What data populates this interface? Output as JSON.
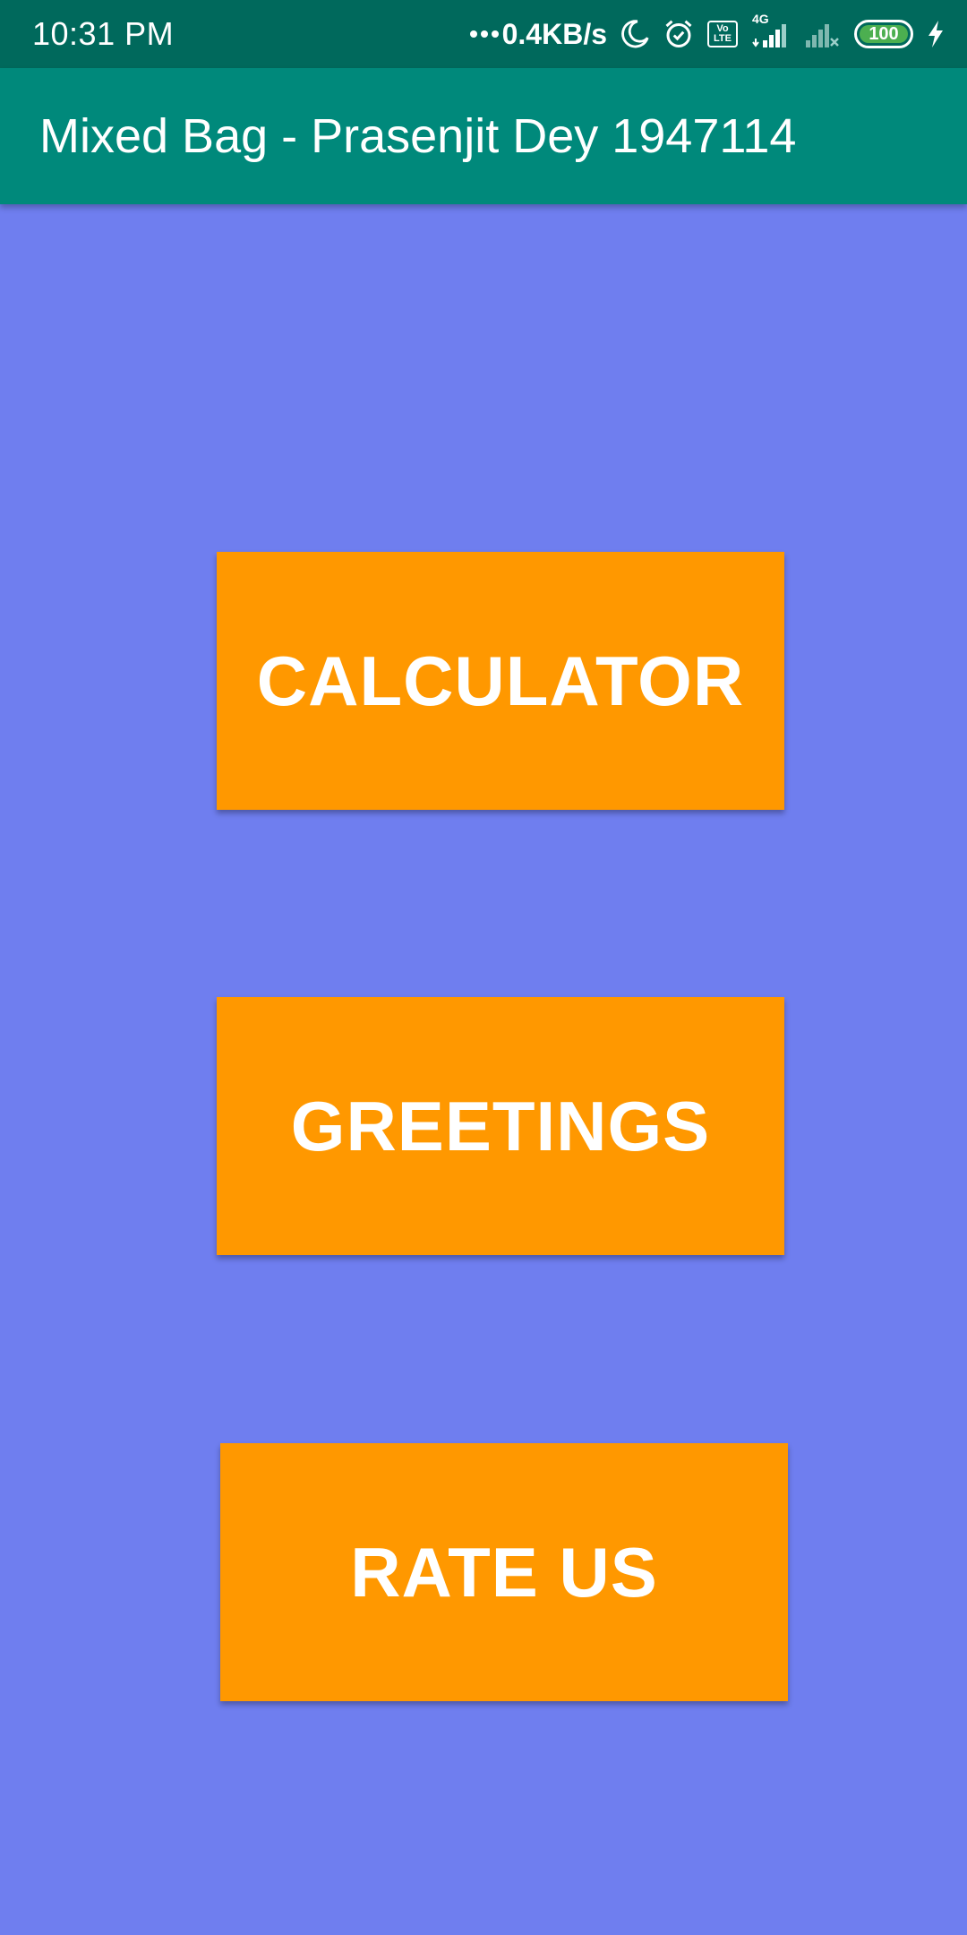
{
  "status_bar": {
    "time": "10:31 PM",
    "network_speed": "0.4KB/s",
    "network_type": "4G",
    "volte_top": "Vo",
    "volte_bottom": "LTE",
    "battery_level": "100",
    "icons": [
      "more-dots-icon",
      "moon-icon",
      "alarm-icon",
      "volte-icon",
      "signal-4g-icon",
      "signal-no-service-icon",
      "battery-icon",
      "charging-bolt-icon"
    ]
  },
  "app_bar": {
    "title": "Mixed Bag - Prasenjit Dey 1947114",
    "color": "#00897B"
  },
  "buttons": {
    "calculator": "CALCULATOR",
    "greetings": "GREETINGS",
    "rate_us": "RATE US",
    "color": "#FF9800"
  },
  "colors": {
    "background": "#6F7EEF",
    "status_bar": "#00695C"
  }
}
